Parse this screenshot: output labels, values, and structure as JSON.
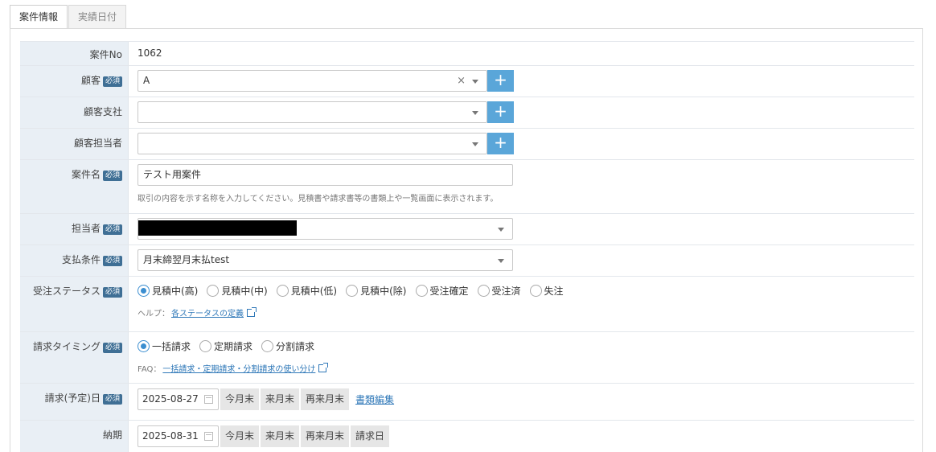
{
  "tabs": [
    {
      "label": "案件情報",
      "active": true
    },
    {
      "label": "実績日付",
      "active": false
    }
  ],
  "form": {
    "case_no": {
      "label": "案件No",
      "value": "1062"
    },
    "customer": {
      "label": "顧客",
      "required": "必須",
      "value": "A",
      "clear": "×"
    },
    "branch": {
      "label": "顧客支社",
      "value": ""
    },
    "contact": {
      "label": "顧客担当者",
      "value": ""
    },
    "case_name": {
      "label": "案件名",
      "required": "必須",
      "value": "テスト用案件",
      "help": "取引の内容を示す名称を入力してください。見積書や請求書等の書類上や一覧画面に表示されます。"
    },
    "assignee": {
      "label": "担当者",
      "required": "必須",
      "value": ""
    },
    "payment": {
      "label": "支払条件",
      "required": "必須",
      "value": "月末締翌月末払test"
    },
    "order_status": {
      "label": "受注ステータス",
      "required": "必須",
      "options": [
        "見積中(高)",
        "見積中(中)",
        "見積中(低)",
        "見積中(除)",
        "受注確定",
        "受注済",
        "失注"
      ],
      "selected": "見積中(高)",
      "help_prefix": "ヘルプ：",
      "help_link": "各ステータスの定義"
    },
    "billing_timing": {
      "label": "請求タイミング",
      "required": "必須",
      "options": [
        "一括請求",
        "定期請求",
        "分割請求"
      ],
      "selected": "一括請求",
      "faq_prefix": "FAQ：",
      "faq_link": "一括請求・定期請求・分割請求の使い分け"
    },
    "billing_date": {
      "label": "請求(予定)日",
      "required": "必須",
      "value": "2025-08-27",
      "buttons": [
        "今月末",
        "来月末",
        "再来月末"
      ],
      "link": "書類編集"
    },
    "delivery": {
      "label": "納期",
      "value": "2025-08-31",
      "buttons": [
        "今月末",
        "来月末",
        "再来月末",
        "請求日"
      ]
    }
  },
  "icons": {
    "plus": "+"
  },
  "colors": {
    "accent": "#5aa6d9",
    "badge": "#3f6f95",
    "label_bg": "#e9eff5",
    "link": "#2f78b8"
  }
}
